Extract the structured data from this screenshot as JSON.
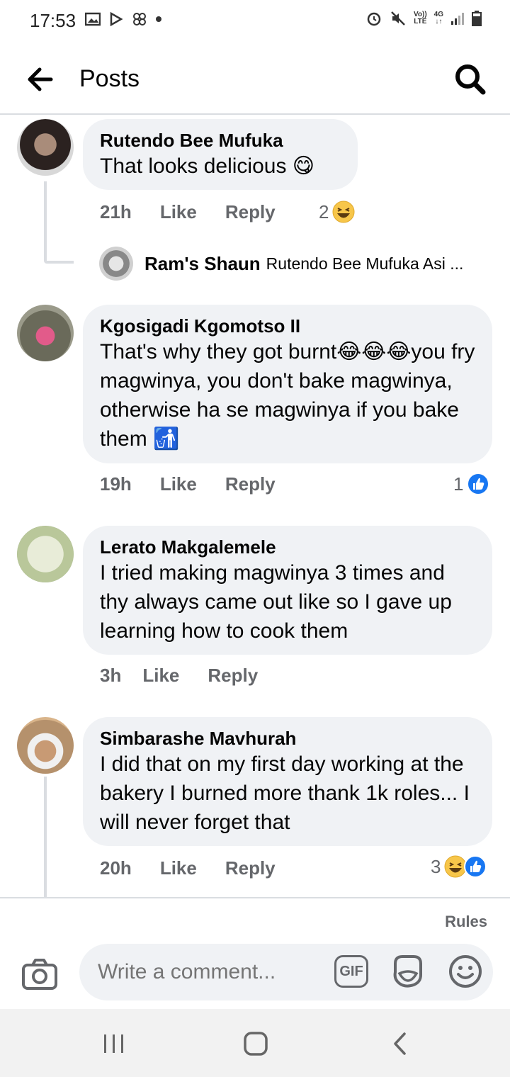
{
  "status_bar": {
    "time": "17:53",
    "left_icons": [
      "gallery-icon",
      "play-store-icon",
      "pinwheel-icon",
      "dot-icon"
    ],
    "right_icons": [
      "alarm-icon",
      "mute-icon",
      "volte-icon",
      "4g-icon",
      "signal-icon",
      "battery-icon"
    ],
    "volte_top": "Vo))",
    "volte_bottom": "LTE",
    "network_top": "4G",
    "network_bottom": "↓↑"
  },
  "header": {
    "title": "Posts"
  },
  "comments": [
    {
      "author": "Rutendo Bee Mufuka",
      "text": "That looks delicious 😋",
      "time": "21h",
      "like_label": "Like",
      "reply_label": "Reply",
      "reaction_count": "2",
      "reactions": [
        "laugh"
      ]
    },
    {
      "author": "Kgosigadi Kgomotso II",
      "text": "That's why they got burnt😂😂😂you fry magwinya, you don't bake magwinya, otherwise ha se magwinya if you bake them 🚮",
      "time": "19h",
      "like_label": "Like",
      "reply_label": "Reply",
      "reaction_count": "1",
      "reactions": [
        "like"
      ]
    },
    {
      "author": "Lerato Makgalemele",
      "text": "I tried making magwinya 3 times and thy always came out like so I gave up learning how to cook them",
      "time": "3h",
      "like_label": "Like",
      "reply_label": "Reply"
    },
    {
      "author": "Simbarashe Mavhurah",
      "text": "I did that on my first day working at the bakery I burned  more thank 1k roles...  I will never forget that",
      "time": "20h",
      "like_label": "Like",
      "reply_label": "Reply",
      "reaction_count": "3",
      "reactions": [
        "laugh",
        "like"
      ]
    }
  ],
  "reply_preview": {
    "author": "Ram's Shaun",
    "text": "Rutendo Bee Mufuka Asi ..."
  },
  "footer": {
    "rules_label": "Rules",
    "comment_placeholder": "Write a comment...",
    "gif_label": "GIF"
  },
  "colors": {
    "bubble": "#f0f2f5",
    "secondary_text": "#65676b",
    "like_blue": "#1877f2",
    "emoji_yellow": "#f7c64a"
  }
}
